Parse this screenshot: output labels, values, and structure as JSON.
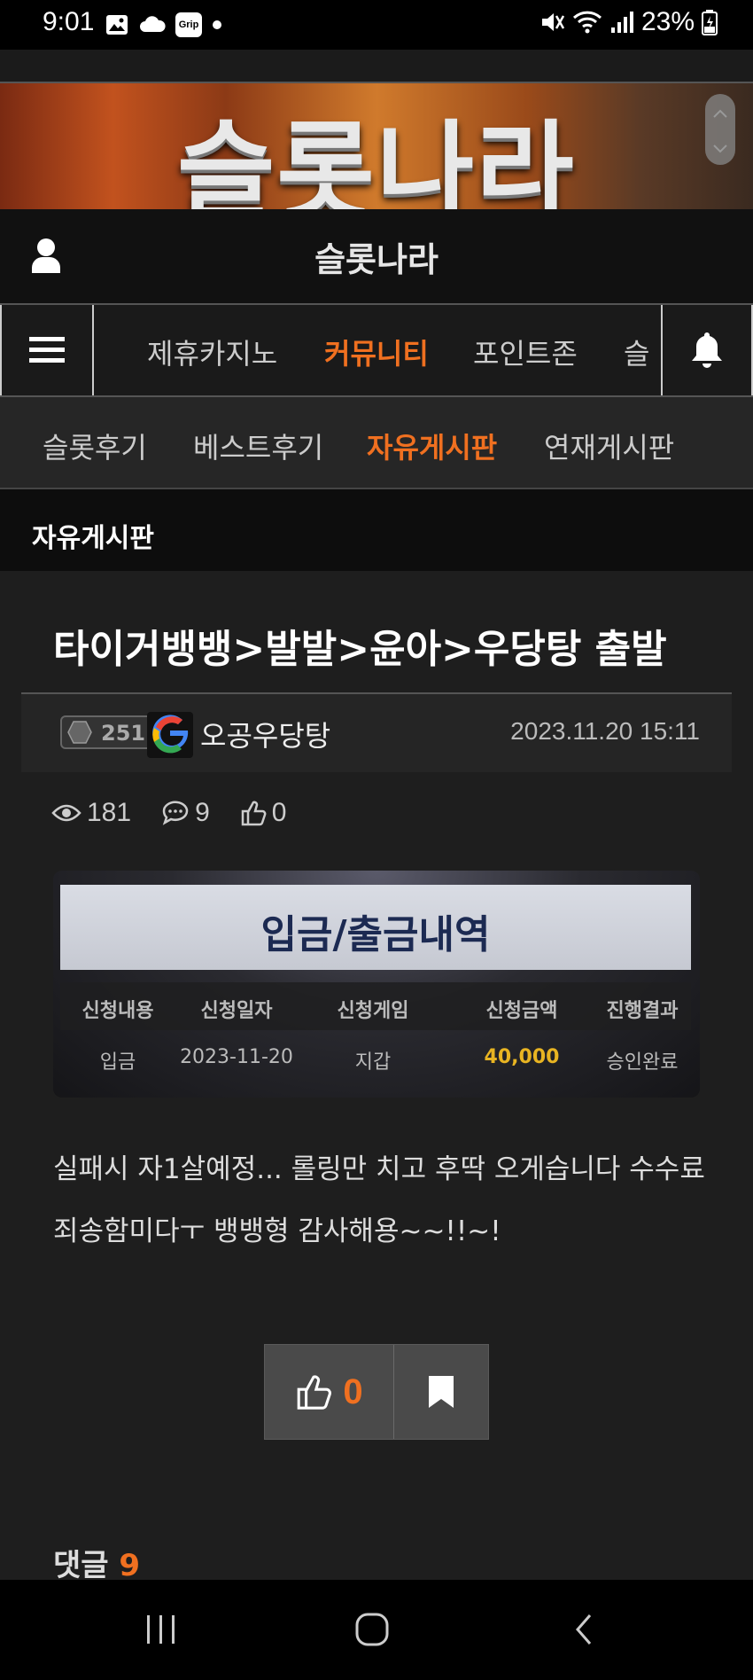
{
  "status_bar": {
    "time": "9:01",
    "battery": "23%",
    "icons": [
      "gallery-icon",
      "cloud-icon",
      "grip-app-icon",
      "dot-icon",
      "mute-icon",
      "wifi-icon",
      "signal-icon",
      "battery-icon"
    ],
    "grip_label": "Grip"
  },
  "banner": {
    "logo_text": "슬롯나라"
  },
  "header": {
    "site_title": "슬롯나라"
  },
  "main_nav": {
    "items": [
      {
        "label": "제휴카지노",
        "active": false
      },
      {
        "label": "커뮤니티",
        "active": true
      },
      {
        "label": "포인트존",
        "active": false
      },
      {
        "label": "슬",
        "active": false
      }
    ]
  },
  "sub_nav": {
    "items": [
      {
        "label": "슬롯후기",
        "active": false
      },
      {
        "label": "베스트후기",
        "active": false
      },
      {
        "label": "자유게시판",
        "active": true
      },
      {
        "label": "연재게시판",
        "active": false
      }
    ]
  },
  "board": {
    "title": "자유게시판"
  },
  "post": {
    "title": "타이거뱅뱅>발발>윤아>우당탕 출발",
    "level": "251",
    "author": "오공우당탕",
    "date": "2023.11.20 15:11",
    "views": "181",
    "comments": "9",
    "likes": "0",
    "body_line1": "실패시 자1살예정... 롤링만 치고 후딱 오게습니다 수수료",
    "body_line2": "죄송함미다ㅜ 뱅뱅형 감사해용~~!!~!"
  },
  "attachment": {
    "heading": "입금/출금내역",
    "columns": [
      "신청내용",
      "신청일자",
      "신청게임",
      "신청금액",
      "진행결과"
    ],
    "row": [
      "입금",
      "2023-11-20",
      "지갑",
      "40,000",
      "승인완료"
    ]
  },
  "vote": {
    "like_count": "0"
  },
  "comments_section": {
    "label": "댓글",
    "count": "9"
  },
  "colors": {
    "accent": "#f07020",
    "background": "#1e1e1e",
    "amount": "#e8b422"
  }
}
